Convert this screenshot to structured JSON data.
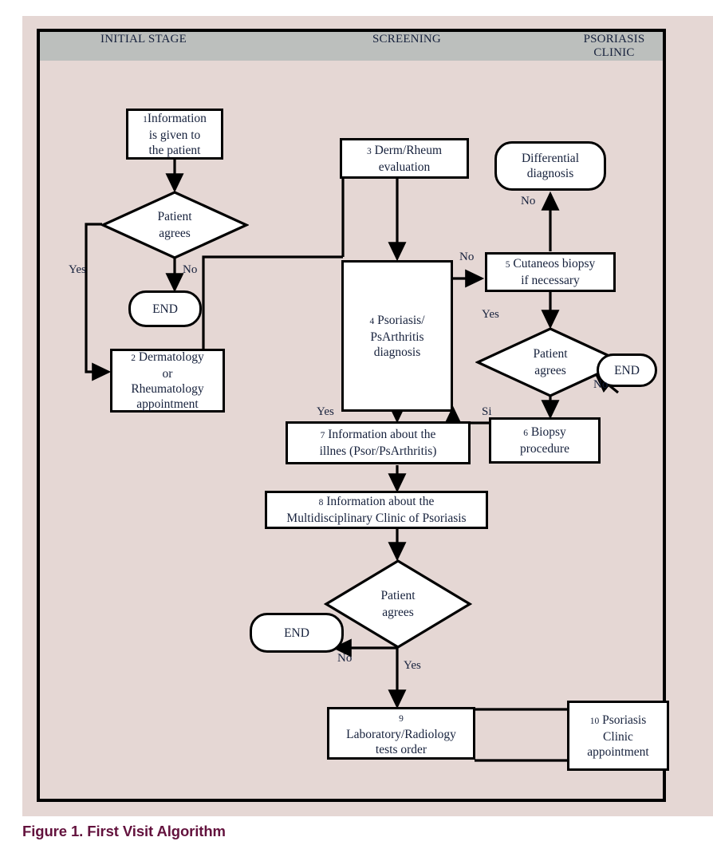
{
  "figure": {
    "caption": "Figure 1. First Visit Algorithm",
    "colors": {
      "background": "#e5d7d4",
      "header_band": "#bcbfbd",
      "node_fill": "#ffffff",
      "stroke": "#000000",
      "text": "#16213c",
      "caption": "#63123d"
    }
  },
  "header": {
    "columns": [
      {
        "label": "INITIAL STAGE"
      },
      {
        "label": "SCREENING"
      },
      {
        "label": "PSORIASIS\nCLINIC"
      }
    ]
  },
  "nodes": {
    "n1": {
      "num": "1",
      "text": "Information\nis given to\nthe patient"
    },
    "n2": {
      "num": "2",
      "text": " Dermatology\nor\nRheumatology\nappointment"
    },
    "n3": {
      "num": "3",
      "text": " Derm/Rheum\nevaluation"
    },
    "n4": {
      "num": "4",
      "text": " Psoriasis/\nPsArthritis\ndiagnosis"
    },
    "n5": {
      "num": "5",
      "text": " Cutaneos biopsy\nif necessary"
    },
    "n6": {
      "num": "6",
      "text": " Biopsy\nprocedure"
    },
    "n7": {
      "num": "7",
      "text": " Information about the\nillnes (Psor/PsArthritis)"
    },
    "n8": {
      "num": "8",
      "text": " Information about the\nMultidisciplinary Clinic of Psoriasis"
    },
    "n9": {
      "num": "9",
      "text": "\nLaboratory/Radiology\ntests order"
    },
    "n10": {
      "num": "10",
      "text": " Psoriasis\nClinic\nappointment"
    },
    "d1": {
      "text": "Patient\nagrees"
    },
    "d2": {
      "text": "Patient\nagrees"
    },
    "d3": {
      "text": "Patient\nagrees"
    },
    "end1": {
      "text": "END"
    },
    "end2": {
      "text": "END"
    },
    "end3": {
      "text": "END"
    },
    "diff": {
      "text": "Differential\ndiagnosis"
    }
  },
  "edge_labels": {
    "d1_yes": "Yes",
    "d1_no": "No",
    "n4_no": "No",
    "n4_yes": "Yes",
    "diff_no": "No",
    "d2_yes": "Yes",
    "d2_no": "No",
    "d2_si": "Si",
    "d3_no": "No",
    "d3_yes": "Yes"
  }
}
